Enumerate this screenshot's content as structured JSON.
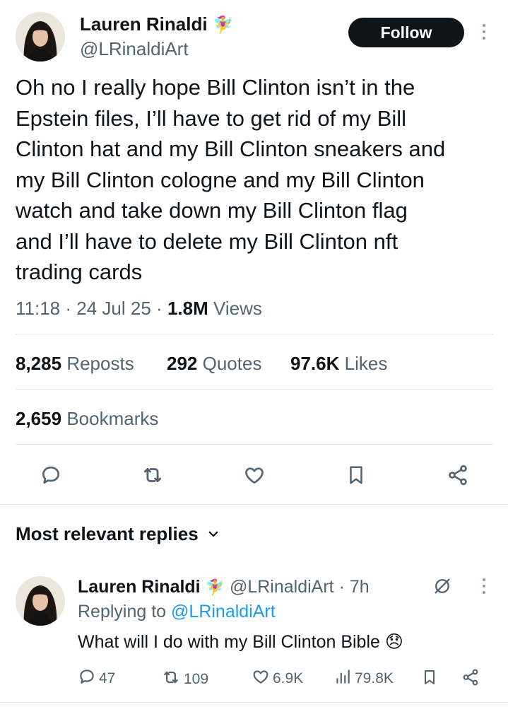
{
  "tweet": {
    "author_name": "Lauren Rinaldi",
    "author_emoji": "🧚‍♀️",
    "author_handle": "@LRinaldiArt",
    "follow_label": "Follow",
    "text": "Oh no I really hope Bill Clinton isn’t in the\nEpstein files, I’ll have to get rid of my Bill\nClinton hat and my Bill Clinton sneakers and\nmy Bill Clinton cologne and my Bill Clinton\nwatch and take down my Bill Clinton flag\nand I’ll have to delete my Bill Clinton nft\ntrading cards",
    "time": "11:18",
    "date": "24 Jul 25",
    "sep": "·",
    "views_count": "1.8M",
    "views_label": "Views"
  },
  "stats": {
    "reposts_count": "8,285",
    "reposts_label": "Reposts",
    "quotes_count": "292",
    "quotes_label": "Quotes",
    "likes_count": "97.6K",
    "likes_label": "Likes",
    "bookmarks_count": "2,659",
    "bookmarks_label": "Bookmarks"
  },
  "actions": [
    "reply-icon",
    "repost-icon",
    "like-icon",
    "bookmark-icon",
    "share-icon"
  ],
  "replies": {
    "section_title": "Most relevant replies",
    "items": [
      {
        "author_name": "Lauren Rinaldi",
        "author_emoji": "🧚‍♀️",
        "author_handle": "@LRinaldiArt",
        "age": "· 7h",
        "replying_prefix": "Replying to",
        "replying_to": "@LRinaldiArt",
        "text": "What will I do with my Bill Clinton Bible",
        "text_emoji": "😞",
        "reply_count": "47",
        "repost_count": "109",
        "like_count": "6.9K",
        "view_count": "79.8K"
      }
    ]
  },
  "colors": {
    "text": "#0f1419",
    "muted": "#536471",
    "link": "#1d9bf0",
    "divider": "#e6ecf0",
    "follow_bg": "#0f1419"
  }
}
